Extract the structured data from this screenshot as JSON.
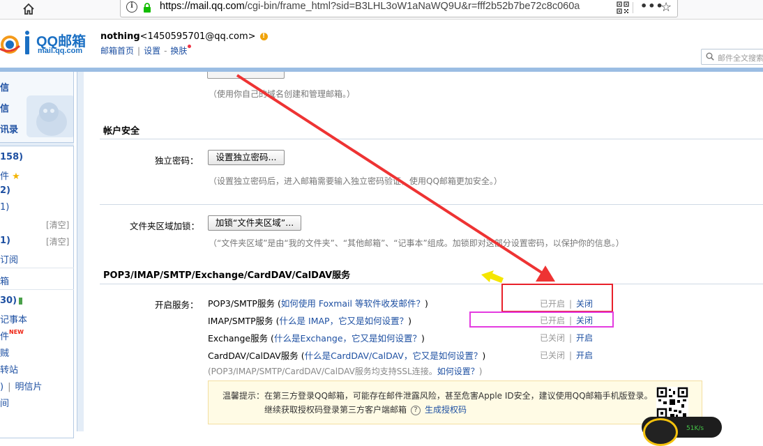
{
  "browser": {
    "url_host": "https://mail.qq.com",
    "url_path": "/cgi-bin/frame_html?sid=B3LHL3oW1aNaWQ9U&r=fff2b52b7be72c8c060a",
    "more_label": "•••",
    "star_label": "☆"
  },
  "header": {
    "logo_text": "QQ邮箱",
    "logo_domain": "mail.qq.com",
    "user_name": "nothing",
    "user_email": "<1450595701@qq.com>",
    "warn_label": "!",
    "links": [
      "邮箱首页",
      "设置",
      "换肤"
    ],
    "link_separator": "|",
    "link_dash": "-",
    "search_placeholder": "邮件全文搜索"
  },
  "sidebar": {
    "top_items": [
      "信",
      "信",
      "讯录"
    ],
    "rows": [
      {
        "text": "158)",
        "bold": true
      },
      {
        "text": "件",
        "star": "★"
      },
      {
        "text": "2)",
        "bold": true
      },
      {
        "text": "1)"
      },
      {
        "text": "",
        "clear": "[清空]"
      },
      {
        "text": "1)",
        "bold": true,
        "clear": "[清空]"
      },
      {
        "text": "订阅"
      },
      {
        "text": "箱"
      },
      {
        "text": "30)",
        "bold": true
      },
      {
        "text": "记事本"
      },
      {
        "text": "件",
        "new": "NEW"
      },
      {
        "text": "贼"
      },
      {
        "text": "转站"
      },
      {
        "text": ")",
        "extra": "明信片"
      },
      {
        "text": "间"
      }
    ]
  },
  "content": {
    "domain_hint": "（使用你自己的域名创建和管理邮箱。）",
    "security_title": "帐户安全",
    "password_label": "独立密码：",
    "password_button": "设置独立密码...",
    "password_hint": "（设置独立密码后，进入邮箱需要输入独立密码验证，使用QQ邮箱更加安全。）",
    "folder_lock_label": "文件夹区域加锁：",
    "folder_lock_button": "加锁“文件夹区域”...",
    "folder_lock_hint": "（“文件夹区域”是由“我的文件夹”、“其他邮箱”、“记事本”组成。加锁即对这部分设置密码，以保护你的信息。）",
    "services_title": "POP3/IMAP/SMTP/Exchange/CardDAV/CalDAV服务",
    "services_label": "开启服务：",
    "services": [
      {
        "name": "POP3/SMTP服务",
        "open_paren": " (",
        "link": "如何使用 Foxmail 等软件收发邮件？",
        "close_paren": ")",
        "status": "已开启",
        "action": "关闭"
      },
      {
        "name": "IMAP/SMTP服务",
        "open_paren": " (",
        "link": "什么是 IMAP，它又是如何设置？",
        "close_paren": ")",
        "status": "已开启",
        "action": "关闭"
      },
      {
        "name": "Exchange服务",
        "open_paren": " (",
        "link": "什么是Exchange，它又是如何设置？",
        "close_paren": ")",
        "status": "已关闭",
        "action": "开启"
      },
      {
        "name": "CardDAV/CalDAV服务",
        "open_paren": " (",
        "link": "什么是CardDAV/CalDAV，它又是如何设置？",
        "close_paren": ")",
        "status": "已关闭",
        "action": "开启"
      }
    ],
    "status_separator": "|",
    "ssl_note": "(POP3/IMAP/SMTP/CardDAV/CalDAV服务均支持SSL连接。",
    "ssl_link": "如何设置？",
    "ssl_close": ")",
    "tip_line1": "温馨提示：在第三方登录QQ邮箱，可能存在邮件泄露风险，甚至危害Apple ID安全，建议使用QQ邮箱手机版登录。",
    "tip_line2": "继续获取授权码登录第三方客户端邮箱",
    "tip_help": "?",
    "tip_link": "生成授权码"
  },
  "widget": {
    "speed": "51K/s"
  },
  "colors": {
    "link": "#1e50a2",
    "header_band": "#9bbde3",
    "annotation_red": "#e8202a",
    "annotation_pink": "#e33be0",
    "annotation_yellow": "#f5e600"
  }
}
